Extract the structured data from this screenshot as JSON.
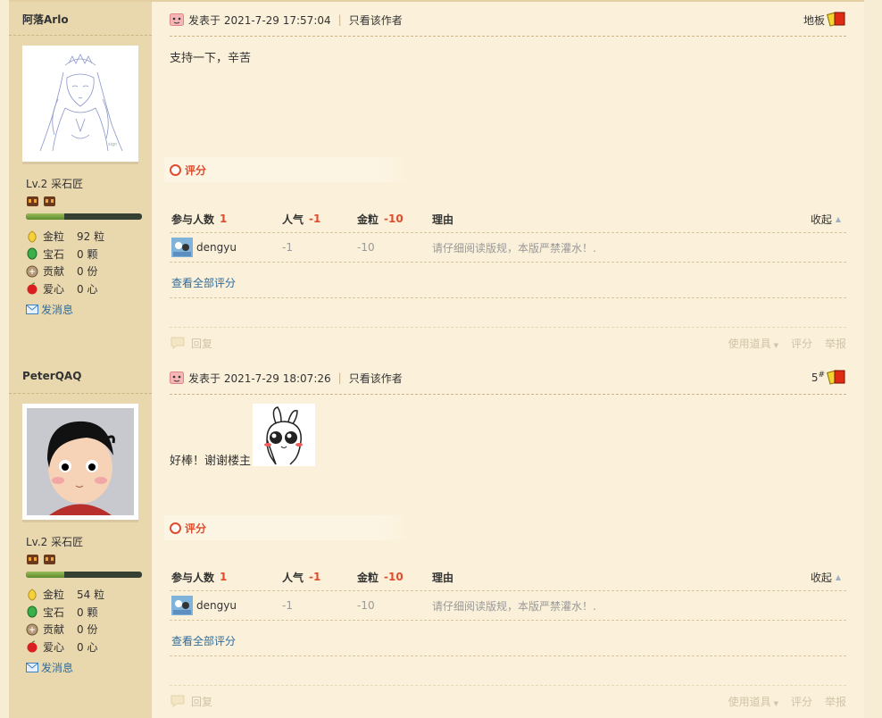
{
  "posts": [
    {
      "author": "阿落Arlo",
      "level": "Lv.2 采石匠",
      "exp_fraction": 0.33,
      "stats": [
        {
          "icon": "gold-coin-icon",
          "label": "金粒",
          "value": "92 粒"
        },
        {
          "icon": "green-gem-icon",
          "label": "宝石",
          "value": "0 颗"
        },
        {
          "icon": "contribution-icon",
          "label": "贡献",
          "value": "0 份"
        },
        {
          "icon": "apple-love-icon",
          "label": "爱心",
          "value": "0 心"
        }
      ],
      "send_message": "发消息",
      "posted_at": "发表于 2021-7-29 17:57:04",
      "only_author": "只看该作者",
      "floor": "地板",
      "floor_sup": "",
      "content": "支持一下，辛苦",
      "rating": {
        "title": "评分",
        "participants_label": "参与人数",
        "participants": "1",
        "popularity_label": "人气",
        "popularity": "-1",
        "gold_label": "金粒",
        "gold": "-10",
        "reason_label": "理由",
        "collapse": "收起",
        "entries": [
          {
            "user": "dengyu",
            "popularity": "-1",
            "gold": "-10",
            "reason": "请仔细阅读版规，本版严禁灌水！."
          }
        ],
        "view_all": "查看全部评分"
      },
      "footer": {
        "reply": "回复",
        "use_item": "使用道具",
        "rate": "评分",
        "report": "举报"
      }
    },
    {
      "author": "PeterQAQ",
      "level": "Lv.2 采石匠",
      "exp_fraction": 0.33,
      "stats": [
        {
          "icon": "gold-coin-icon",
          "label": "金粒",
          "value": "54 粒"
        },
        {
          "icon": "green-gem-icon",
          "label": "宝石",
          "value": "0 颗"
        },
        {
          "icon": "contribution-icon",
          "label": "贡献",
          "value": "0 份"
        },
        {
          "icon": "apple-love-icon",
          "label": "爱心",
          "value": "0 心"
        }
      ],
      "send_message": "发消息",
      "posted_at": "发表于 2021-7-29 18:07:26",
      "only_author": "只看该作者",
      "floor": "5",
      "floor_sup": "#",
      "content": "好棒！谢谢楼主",
      "rating": {
        "title": "评分",
        "participants_label": "参与人数",
        "participants": "1",
        "popularity_label": "人气",
        "popularity": "-1",
        "gold_label": "金粒",
        "gold": "-10",
        "reason_label": "理由",
        "collapse": "收起",
        "entries": [
          {
            "user": "dengyu",
            "popularity": "-1",
            "gold": "-10",
            "reason": "请仔细阅读版规，本版严禁灌水！."
          }
        ],
        "view_all": "查看全部评分"
      },
      "footer": {
        "reply": "回复",
        "use_item": "使用道具",
        "rate": "评分",
        "report": "举报"
      }
    }
  ],
  "colors": {
    "sidebar": "#e9d7ae",
    "main": "#fbf0d9",
    "accent_red": "#e04d2e",
    "link_blue": "#2f6c9c"
  }
}
